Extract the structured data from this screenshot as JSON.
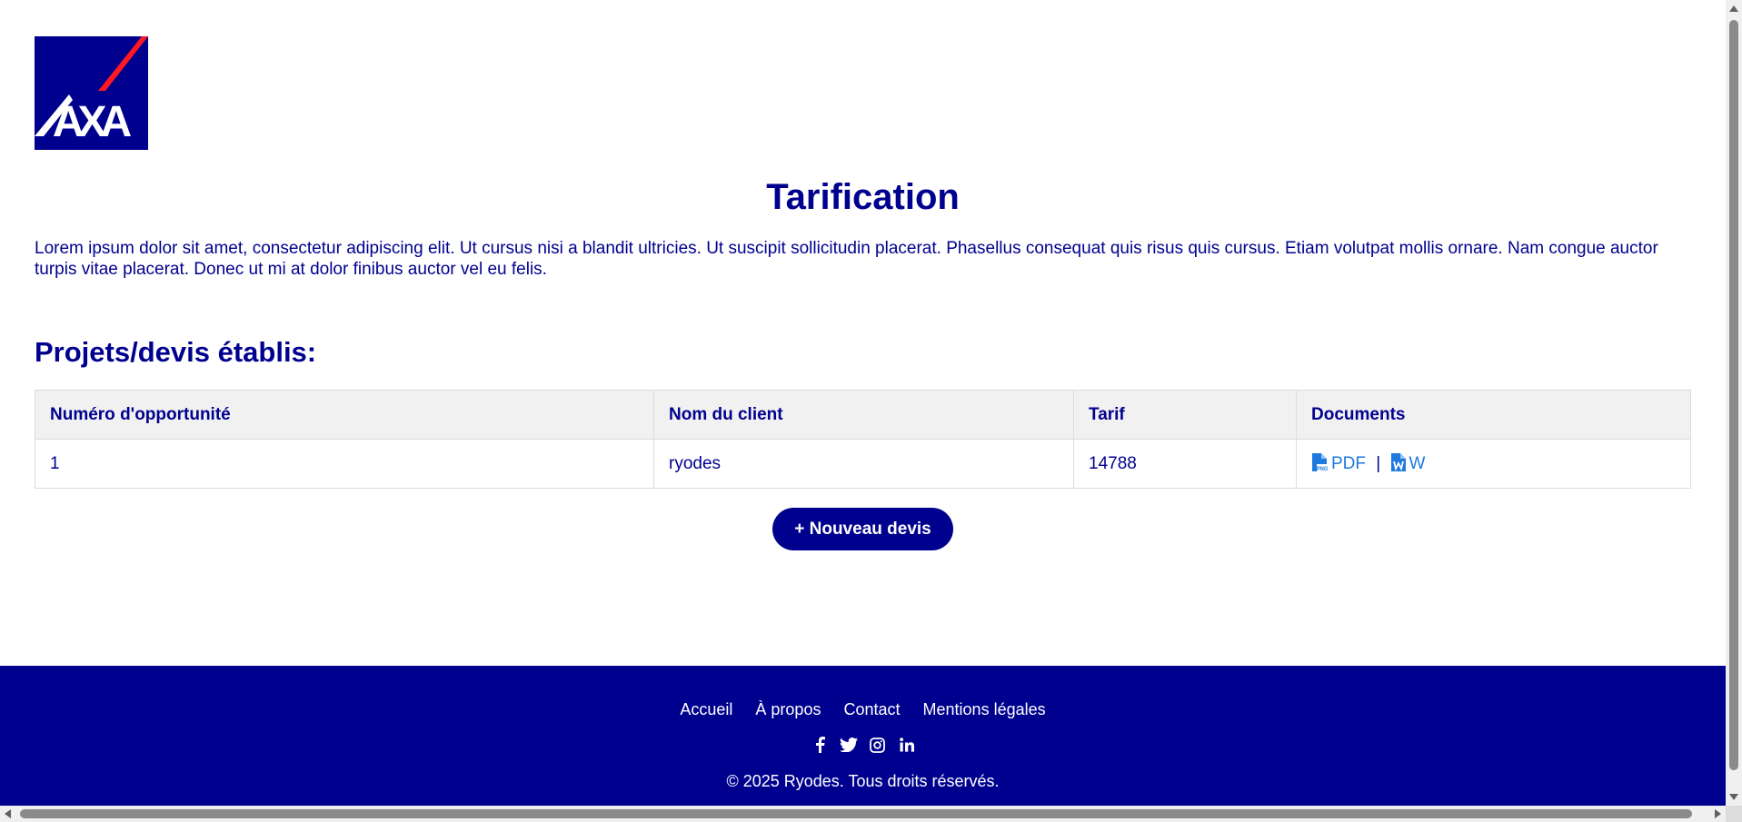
{
  "brand": {
    "logo_text": "AXA",
    "logo_color": "#00008f",
    "stripe_color": "#ff1721"
  },
  "page": {
    "title": "Tarification",
    "intro": "Lorem ipsum dolor sit amet, consectetur adipiscing elit. Ut cursus nisi a blandit ultricies. Ut suscipit sollicitudin placerat. Phasellus consequat quis risus quis cursus. Etiam volutpat mollis ornare. Nam congue auctor turpis vitae placerat. Donec ut mi at dolor finibus auctor vel eu felis."
  },
  "projects": {
    "title": "Projets/devis établis:",
    "headers": [
      "Numéro d'opportunité",
      "Nom du client",
      "Tarif",
      "Documents"
    ],
    "rows": [
      {
        "number": "1",
        "client": "ryodes",
        "tarif": "14788",
        "pdf_label": "PDF",
        "separator": "|",
        "word_label": "W"
      }
    ],
    "new_button": "+ Nouveau devis"
  },
  "footer": {
    "links": [
      "Accueil",
      "À propos",
      "Contact",
      "Mentions légales"
    ],
    "socials": [
      "facebook-icon",
      "twitter-icon",
      "instagram-icon",
      "linkedin-icon"
    ],
    "copyright": "© 2025 Ryodes. Tous droits réservés."
  },
  "colors": {
    "primary": "#00008f",
    "link": "#1f7ae0",
    "header_bg": "#f1f1f1"
  }
}
